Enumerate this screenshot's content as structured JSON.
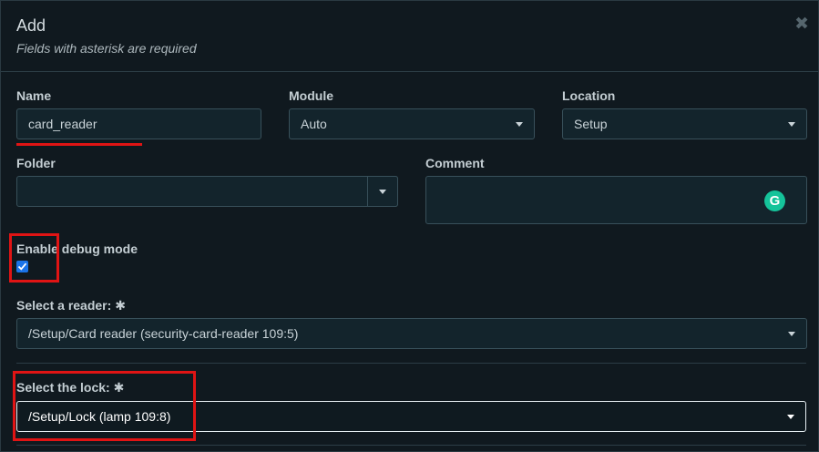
{
  "dialog": {
    "title": "Add",
    "subtitle": "Fields with asterisk are required",
    "close_glyph": "✖"
  },
  "form": {
    "name": {
      "label": "Name",
      "value": "card_reader"
    },
    "module": {
      "label": "Module",
      "value": "Auto"
    },
    "location": {
      "label": "Location",
      "value": "Setup"
    },
    "folder": {
      "label": "Folder",
      "value": ""
    },
    "comment": {
      "label": "Comment",
      "value": "",
      "grammarly_glyph": "G"
    },
    "debug": {
      "label": "Enable debug mode",
      "checked": true
    },
    "reader": {
      "label": "Select a reader:",
      "required": "✱",
      "value": "/Setup/Card reader (security-card-reader 109:5)"
    },
    "lock": {
      "label": "Select the lock:",
      "required": "✱",
      "value": "/Setup/Lock (lamp 109:8)"
    }
  },
  "colors": {
    "highlight": "#e01414",
    "checkbox": "#1a73e8",
    "grammarly": "#15c39a"
  },
  "icons": [
    "close-icon",
    "chevron-down-icon",
    "grammarly-icon",
    "check-icon",
    "asterisk-icon"
  ]
}
